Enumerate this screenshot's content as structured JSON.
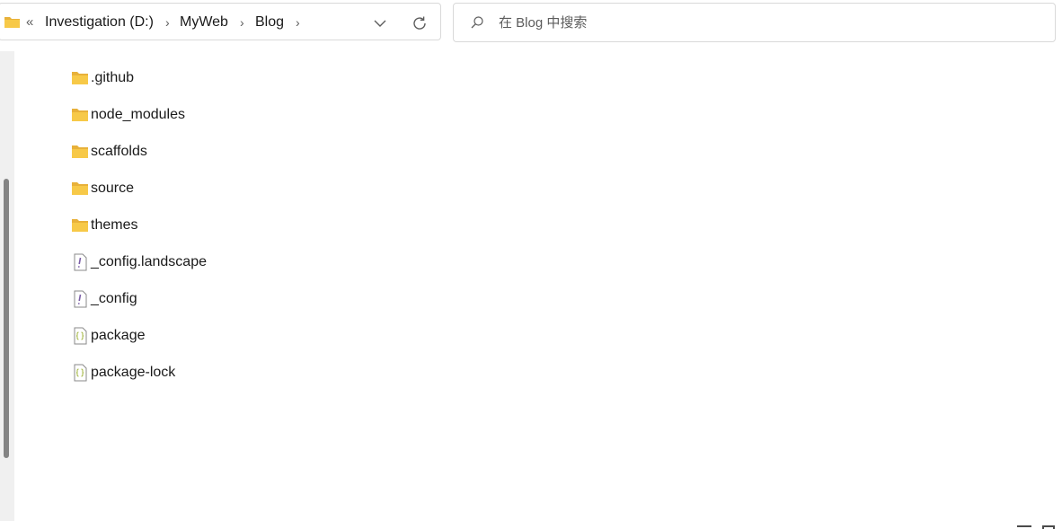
{
  "address_bar": {
    "overflow_label": "«",
    "breadcrumbs": [
      {
        "label": "Investigation (D:)"
      },
      {
        "label": "MyWeb"
      },
      {
        "label": "Blog"
      }
    ],
    "separator": "›",
    "icons": {
      "location": "folder-icon",
      "dropdown": "chevron-down-icon",
      "refresh": "refresh-icon"
    }
  },
  "search": {
    "placeholder": "在 Blog 中搜索",
    "icon": "search-icon"
  },
  "files": [
    {
      "name": ".github",
      "type": "folder"
    },
    {
      "name": "node_modules",
      "type": "folder"
    },
    {
      "name": "scaffolds",
      "type": "folder"
    },
    {
      "name": "source",
      "type": "folder"
    },
    {
      "name": "themes",
      "type": "folder"
    },
    {
      "name": "_config.landscape",
      "type": "yaml"
    },
    {
      "name": "_config",
      "type": "yaml"
    },
    {
      "name": "package",
      "type": "json"
    },
    {
      "name": "package-lock",
      "type": "json"
    }
  ],
  "colors": {
    "folder": "#f7c948",
    "folder_dark": "#e8b13a",
    "yaml_accent": "#7b5ea7",
    "json_accent": "#a3b640",
    "scrollbar": "#848484"
  }
}
